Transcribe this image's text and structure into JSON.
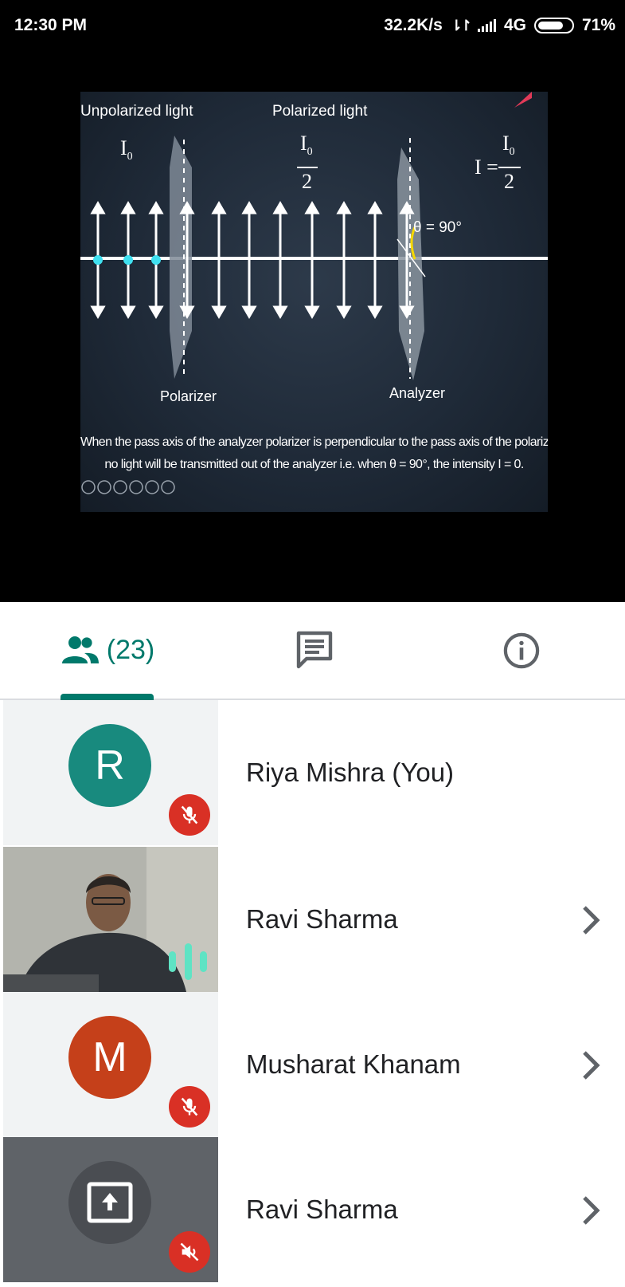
{
  "status_bar": {
    "time": "12:30 PM",
    "network_speed": "32.2K/s",
    "network_type": "4G",
    "battery": "71%"
  },
  "slide": {
    "label_unpolarized": "Unpolarized light",
    "label_polarized": "Polarized light",
    "label_polarizer": "Polarizer",
    "label_analyzer": "Analyzer",
    "intensity_i0": "I",
    "intensity_sub": "0",
    "intensity_denominator": "2",
    "final_intensity_lhs": "I =",
    "angle_label": "θ = 90°",
    "caption_line1": "When the pass axis of the analyzer polarizer is perpendicular to the pass axis of the polarizer,",
    "caption_line2": "no light will be transmitted out of the analyzer i.e. when θ = 90°, the intensity I = 0."
  },
  "tabs": {
    "people_icon": "people-icon",
    "people_count": "(23)",
    "chat_icon": "chat-icon",
    "info_icon": "info-icon",
    "active_tab": "people"
  },
  "participants": [
    {
      "name": "Riya Mishra (You)",
      "initial": "R",
      "avatar_color": "#188a7e",
      "muted": true,
      "has_chevron": false
    },
    {
      "name": "Ravi Sharma",
      "initial": "",
      "video": true,
      "speaking": true,
      "has_chevron": true
    },
    {
      "name": "Musharat Khanam",
      "initial": "M",
      "avatar_color": "#c5401a",
      "muted": true,
      "has_chevron": true
    },
    {
      "name": "Ravi Sharma",
      "initial": "",
      "presenting": true,
      "muted": true,
      "has_chevron": true
    }
  ],
  "colors": {
    "accent": "#00796b",
    "mute_red": "#d93025",
    "speaking_green": "#5fe3c4"
  }
}
